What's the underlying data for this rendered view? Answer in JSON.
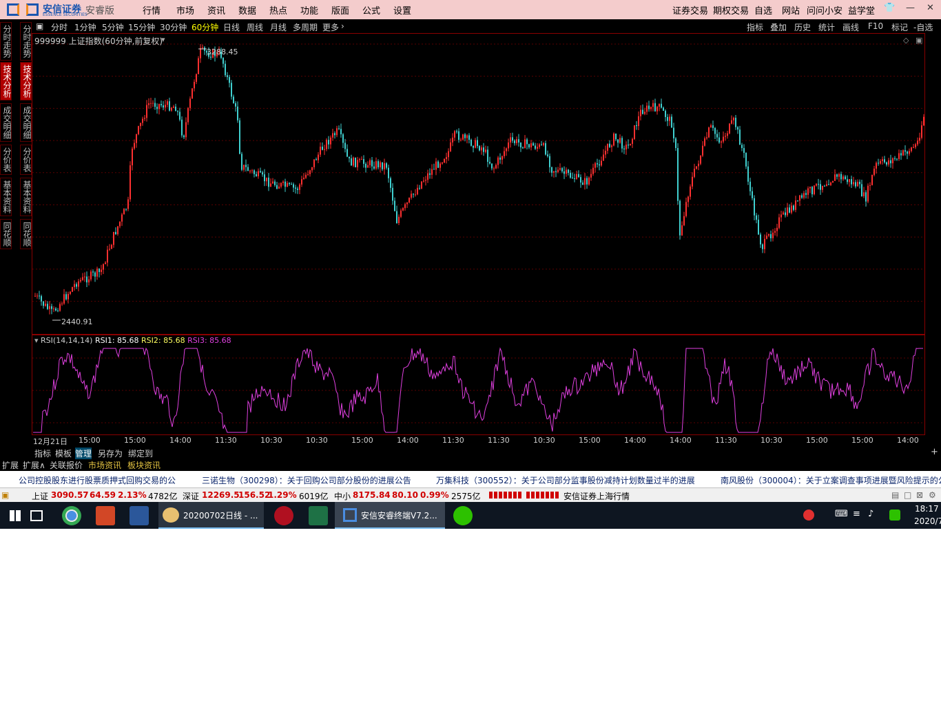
{
  "brand": {
    "name": "安信证券",
    "edition": "安睿版",
    "brand_en": "ESSENCE SECURITIES"
  },
  "menu": [
    "行情",
    "市场",
    "资讯",
    "数据",
    "热点",
    "功能",
    "版面",
    "公式",
    "设置"
  ],
  "right_menu": [
    "证券交易",
    "期权交易",
    "自选",
    "网站",
    "问问小安",
    "益学堂"
  ],
  "left_tabs": [
    "分时走势",
    "技术分析",
    "成交明细",
    "分价表",
    "基本资料",
    "同花顺"
  ],
  "left_tabs_active": 1,
  "periods": [
    "分时",
    "1分钟",
    "5分钟",
    "15分钟",
    "30分钟",
    "60分钟",
    "日线",
    "周线",
    "月线",
    "多周期",
    "更多"
  ],
  "period_active": 5,
  "toolbar_right": [
    "指标",
    "叠加",
    "历史",
    "统计",
    "画线",
    "F10",
    "标记",
    "-自选"
  ],
  "chart": {
    "title": "999999 上证指数(60分钟,前复权)",
    "high_label": "3288.45",
    "low_label": "2440.91"
  },
  "rsi": {
    "name": "RSI(14,14,14)",
    "rsi1": "RSI1: 85.68",
    "rsi2": "RSI2: 85.68",
    "rsi3": "RSI3: 85.68"
  },
  "time_ticks": [
    "12月21日",
    "15:00",
    "15:00",
    "14:00",
    "11:30",
    "10:30",
    "10:30",
    "15:00",
    "14:00",
    "11:30",
    "11:30",
    "10:30",
    "15:00",
    "14:00",
    "14:00",
    "11:30",
    "10:30",
    "15:00",
    "15:00",
    "14:00"
  ],
  "bottom_tabs": [
    "指标",
    "模板",
    "管理",
    "另存为",
    "绑定到"
  ],
  "bottom_tab_active": 2,
  "ext_tabs": [
    "扩展",
    "扩展∧",
    "关联报价",
    "市场资讯",
    "板块资讯"
  ],
  "news": [
    "公司控股股东进行股票质押式回购交易的公",
    "三诺生物（300298）：关于回购公司部分股份的进展公告",
    "万集科技（300552）：关于公司部分监事股份减持计划数量过半的进展",
    "南风股份（300004）：关于立案调查事项进展暨风险提示的公"
  ],
  "indices": [
    {
      "name": "上证",
      "value": "3090.57",
      "change": "64.59",
      "pct": "2.13%",
      "amount": "4782亿"
    },
    {
      "name": "深证",
      "value": "12269.5",
      "change": "156.52",
      "pct": "1.29%",
      "amount": "6019亿"
    },
    {
      "name": "中小",
      "value": "8175.84",
      "change": "80.10",
      "pct": "0.99%",
      "amount": "2575亿"
    }
  ],
  "status_market": "安信证券上海行情",
  "taskbar": {
    "excel_doc": "20200702日线 - ...",
    "app": "安信安睿终端V7.2...",
    "time": "18:17",
    "date": "2020/7"
  },
  "colors": {
    "up": "#ff3030",
    "down": "#40d0d0",
    "rsi": "#e040e0",
    "frame": "#8b0000",
    "active_tab": "#b00000"
  }
}
